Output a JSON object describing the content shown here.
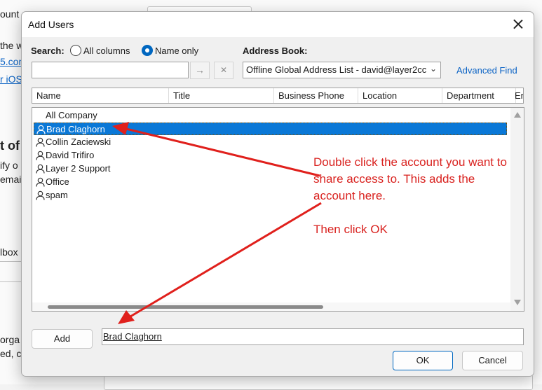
{
  "background": {
    "texts": [
      "ount o",
      "the w",
      "5.com",
      "r iOS",
      "t of",
      "ify o",
      "emai",
      "lbox",
      "orga",
      "ed, c"
    ]
  },
  "dialog": {
    "title": "Add Users",
    "search_label": "Search:",
    "radio_all_columns": "All columns",
    "radio_name_only": "Name only",
    "selected_search_mode": "Name only",
    "search_value": "",
    "go_arrow": "→",
    "clear_x": "✕",
    "address_book_label": "Address Book:",
    "address_book_value": "Offline Global Address List - david@layer2cc",
    "advanced_find": "Advanced Find",
    "columns": [
      "Name",
      "Title",
      "Business Phone",
      "Location",
      "Department",
      "Er"
    ],
    "rows": [
      {
        "name": "All Company",
        "icon": false,
        "selected": false
      },
      {
        "name": "Brad Claghorn",
        "icon": true,
        "selected": true
      },
      {
        "name": "Collin Zaciewski",
        "icon": true,
        "selected": false
      },
      {
        "name": "David Trifiro",
        "icon": true,
        "selected": false
      },
      {
        "name": "Layer 2 Support",
        "icon": true,
        "selected": false
      },
      {
        "name": "Office",
        "icon": true,
        "selected": false
      },
      {
        "name": "spam",
        "icon": true,
        "selected": false
      }
    ],
    "add_button": "Add",
    "add_field_value": "Brad Claghorn",
    "ok_button": "OK",
    "cancel_button": "Cancel"
  },
  "annotation": {
    "line1": "Double click the account you want to share access to. This adds the account here.",
    "line2": "Then click OK",
    "color": "#d9221f"
  },
  "icons": [
    "close-icon",
    "arrow-right-icon",
    "clear-icon",
    "chevron-down-icon",
    "user-icon",
    "scroll-up-icon",
    "scroll-down-icon"
  ]
}
